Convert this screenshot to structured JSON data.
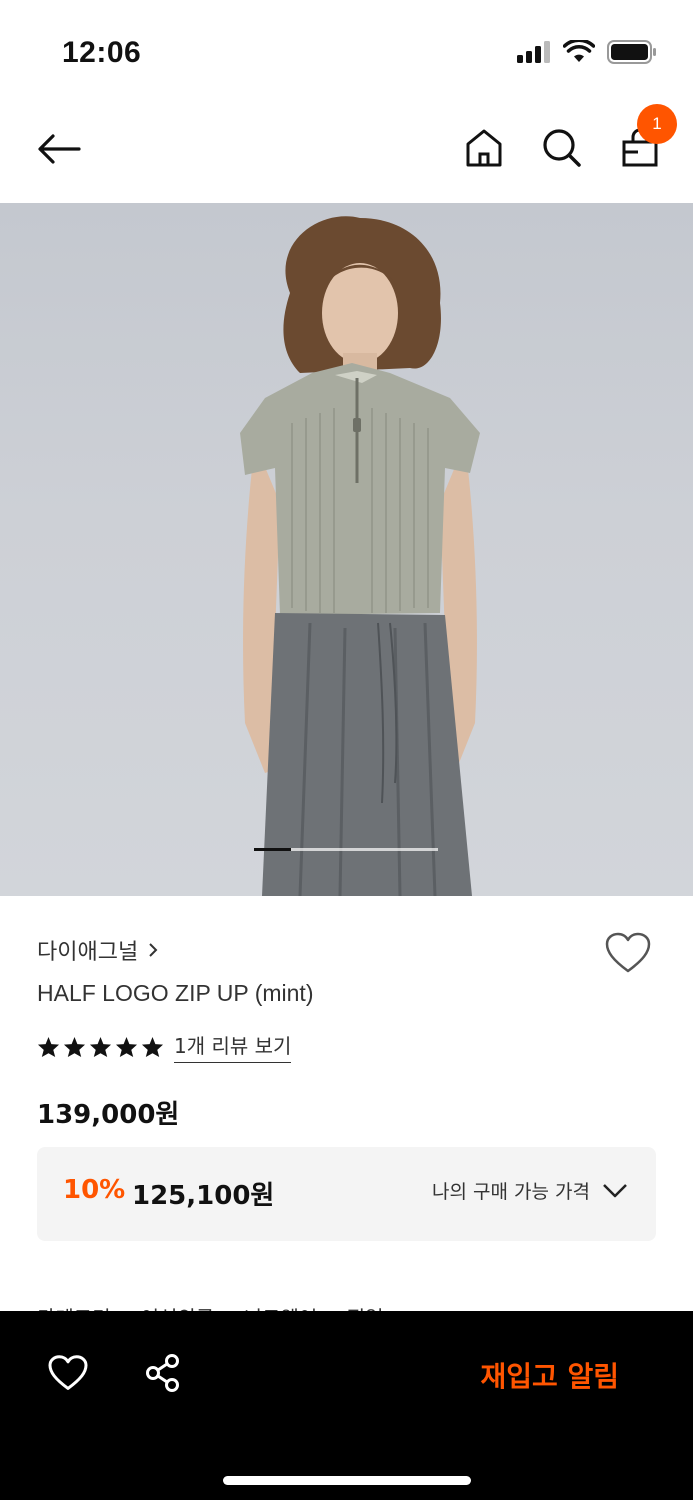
{
  "status_bar": {
    "time": "12:06",
    "icons": [
      "signal-icon",
      "wifi-icon",
      "battery-icon"
    ]
  },
  "nav": {
    "icons": [
      "back-arrow-icon",
      "home-icon",
      "search-icon",
      "cart-icon"
    ],
    "cart_count": "1"
  },
  "gallery": {
    "current_page": 1,
    "total_pages": 5
  },
  "product": {
    "brand": "다이애그널",
    "name": "HALF LOGO ZIP UP (mint)",
    "rating": 5,
    "review_link": "1개 리뷰 보기",
    "price": "139,000원",
    "discount_percent": "10%",
    "discount_price": "125,100원",
    "my_price_label": "나의 구매 가능 가격"
  },
  "category": {
    "label": "카테고리",
    "path": "여성의류 > 니트웨어 > 집업"
  },
  "bottom_bar": {
    "restock_label": "재입고 알림"
  },
  "colors": {
    "accent": "#ff5500",
    "bottom_bar_bg": "#000000",
    "discount_box_bg": "#f4f4f4"
  }
}
